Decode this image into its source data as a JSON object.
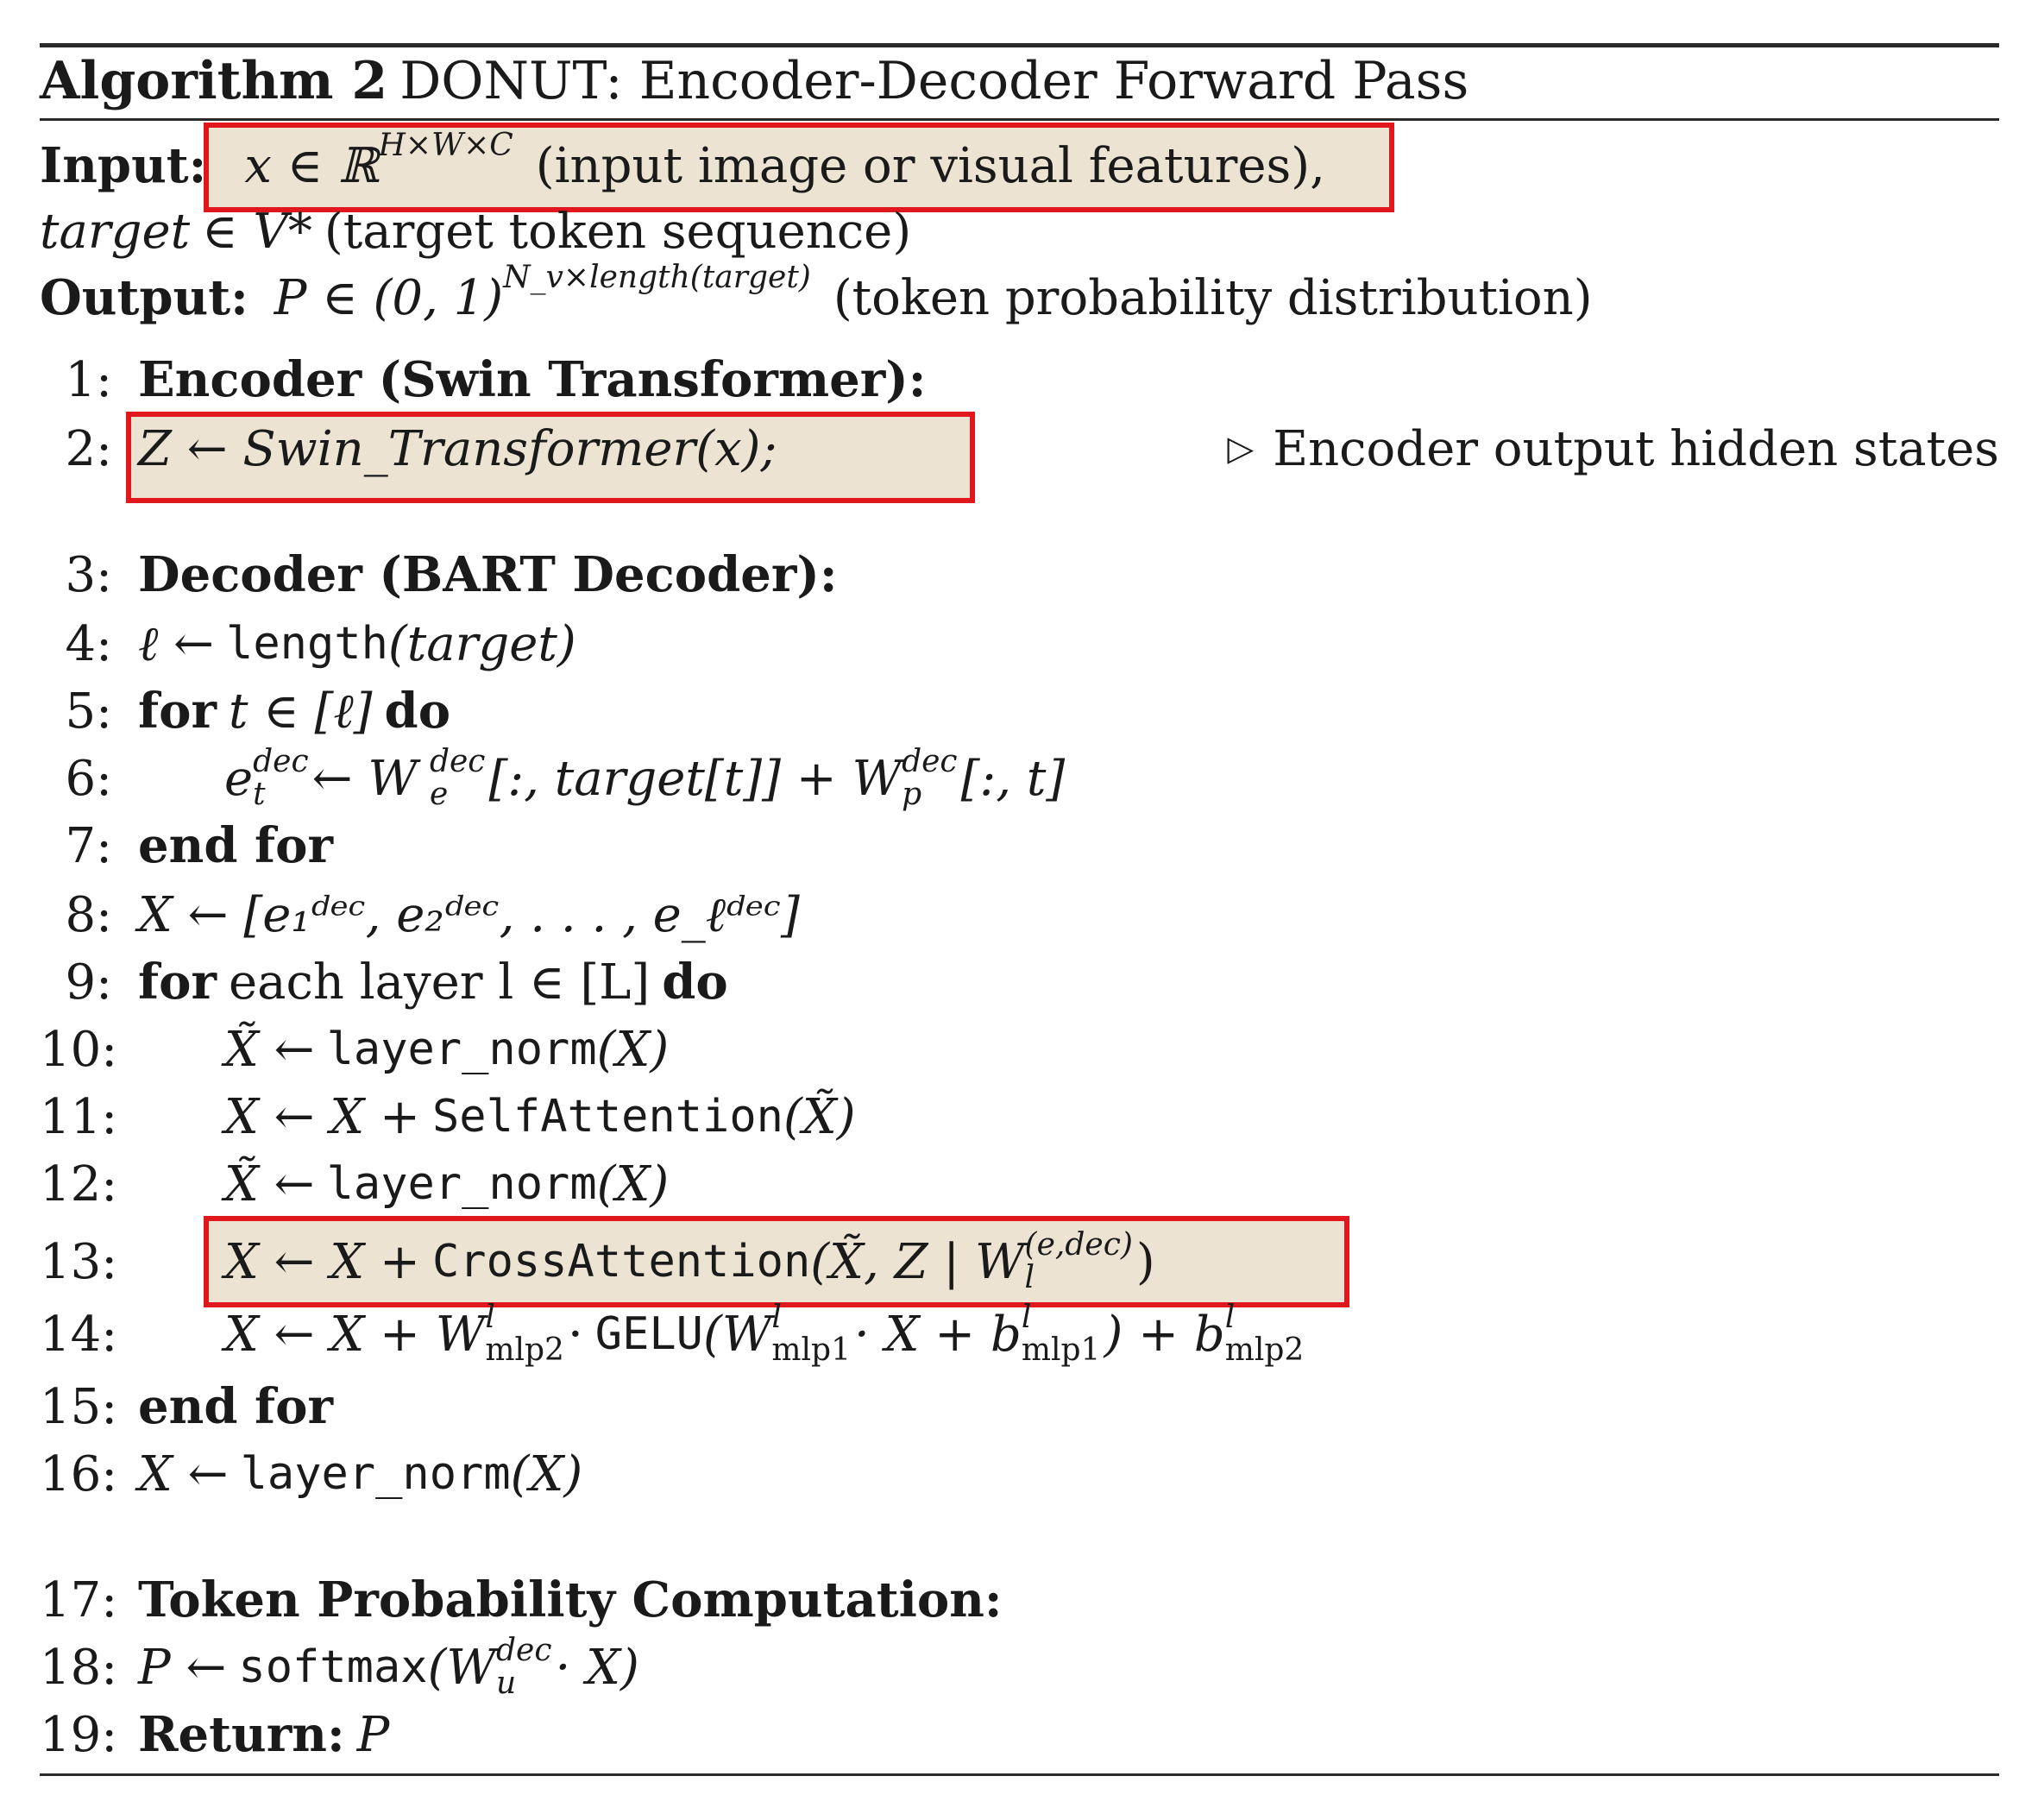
{
  "title": {
    "label": "Algorithm 2",
    "text": "DONUT: Encoder-Decoder Forward Pass"
  },
  "input": {
    "label": "Input:",
    "x": "x ∈ ℝ",
    "x_sup": "H×W×C",
    "x_desc": "(input image or visual features),",
    "target": "target",
    "target_expr": "∈ V*",
    "target_desc": "(target token sequence)"
  },
  "output": {
    "label": "Output:",
    "expr": "P ∈ (0, 1)",
    "sup": "N_v×length(target)",
    "desc": "(token probability distribution)"
  },
  "lines": {
    "n1": "1:",
    "t1": "Encoder (Swin Transformer):",
    "n2": "2:",
    "t2": "Z ← Swin_Transformer(x);",
    "c2": "Encoder output hidden states",
    "n3": "3:",
    "t3": "Decoder (BART Decoder):",
    "n4": "4:",
    "t4a": "ℓ ←",
    "t4b": "length",
    "t4c": "(target)",
    "n5": "5:",
    "t5a": "for",
    "t5b": "t ∈ [ℓ]",
    "t5c": "do",
    "n6": "6:",
    "t6a": "e",
    "t6b": "← W",
    "t6c": "[:, target[t]] + W",
    "t6d": "[:, t]",
    "n7": "7:",
    "t7": "end for",
    "n8": "8:",
    "t8": "X ← [e₁ᵈᵉᶜ, e₂ᵈᵉᶜ, . . . , e_ℓᵈᵉᶜ]",
    "n9": "9:",
    "t9a": "for",
    "t9b": "each layer l ∈ [L]",
    "t9c": "do",
    "n10": "10:",
    "t10a": "X̃ ←",
    "t10b": "layer_norm",
    "t10c": "(X)",
    "n11": "11:",
    "t11a": "X ← X +",
    "t11b": "SelfAttention",
    "t11c": "(X̃)",
    "n12": "12:",
    "t12a": "X̃ ←",
    "t12b": "layer_norm",
    "t12c": "(X)",
    "n13": "13:",
    "t13a": "X ← X +",
    "t13b": "CrossAttention",
    "t13c": "(X̃, Z | W",
    "t13d": "(e,dec)",
    "t13e": ")",
    "n14": "14:",
    "t14a": "X ← X + W",
    "t14b": "· ",
    "t14c": "GELU",
    "t14d": "(W",
    "t14e": "· X + b",
    "t14f": ") + b",
    "n15": "15:",
    "t15": "end for",
    "n16": "16:",
    "t16a": "X ←",
    "t16b": "layer_norm",
    "t16c": "(X)",
    "n17": "17:",
    "t17": "Token Probability Computation:",
    "n18": "18:",
    "t18a": "P ←",
    "t18b": "softmax",
    "t18c": "(W",
    "t18d": "· X)",
    "n19": "19:",
    "t19a": "Return:",
    "t19b": "P"
  },
  "scripts": {
    "dec": "dec",
    "t": "t",
    "e": "e",
    "p": "p",
    "u": "u",
    "l": "l",
    "one": "1",
    "two": "2",
    "ell": "ℓ",
    "mlp1": "mlp1",
    "mlp2": "mlp2"
  },
  "colors": {
    "highlight_fill": "#ece3d3",
    "highlight_border": "#e0181e"
  }
}
